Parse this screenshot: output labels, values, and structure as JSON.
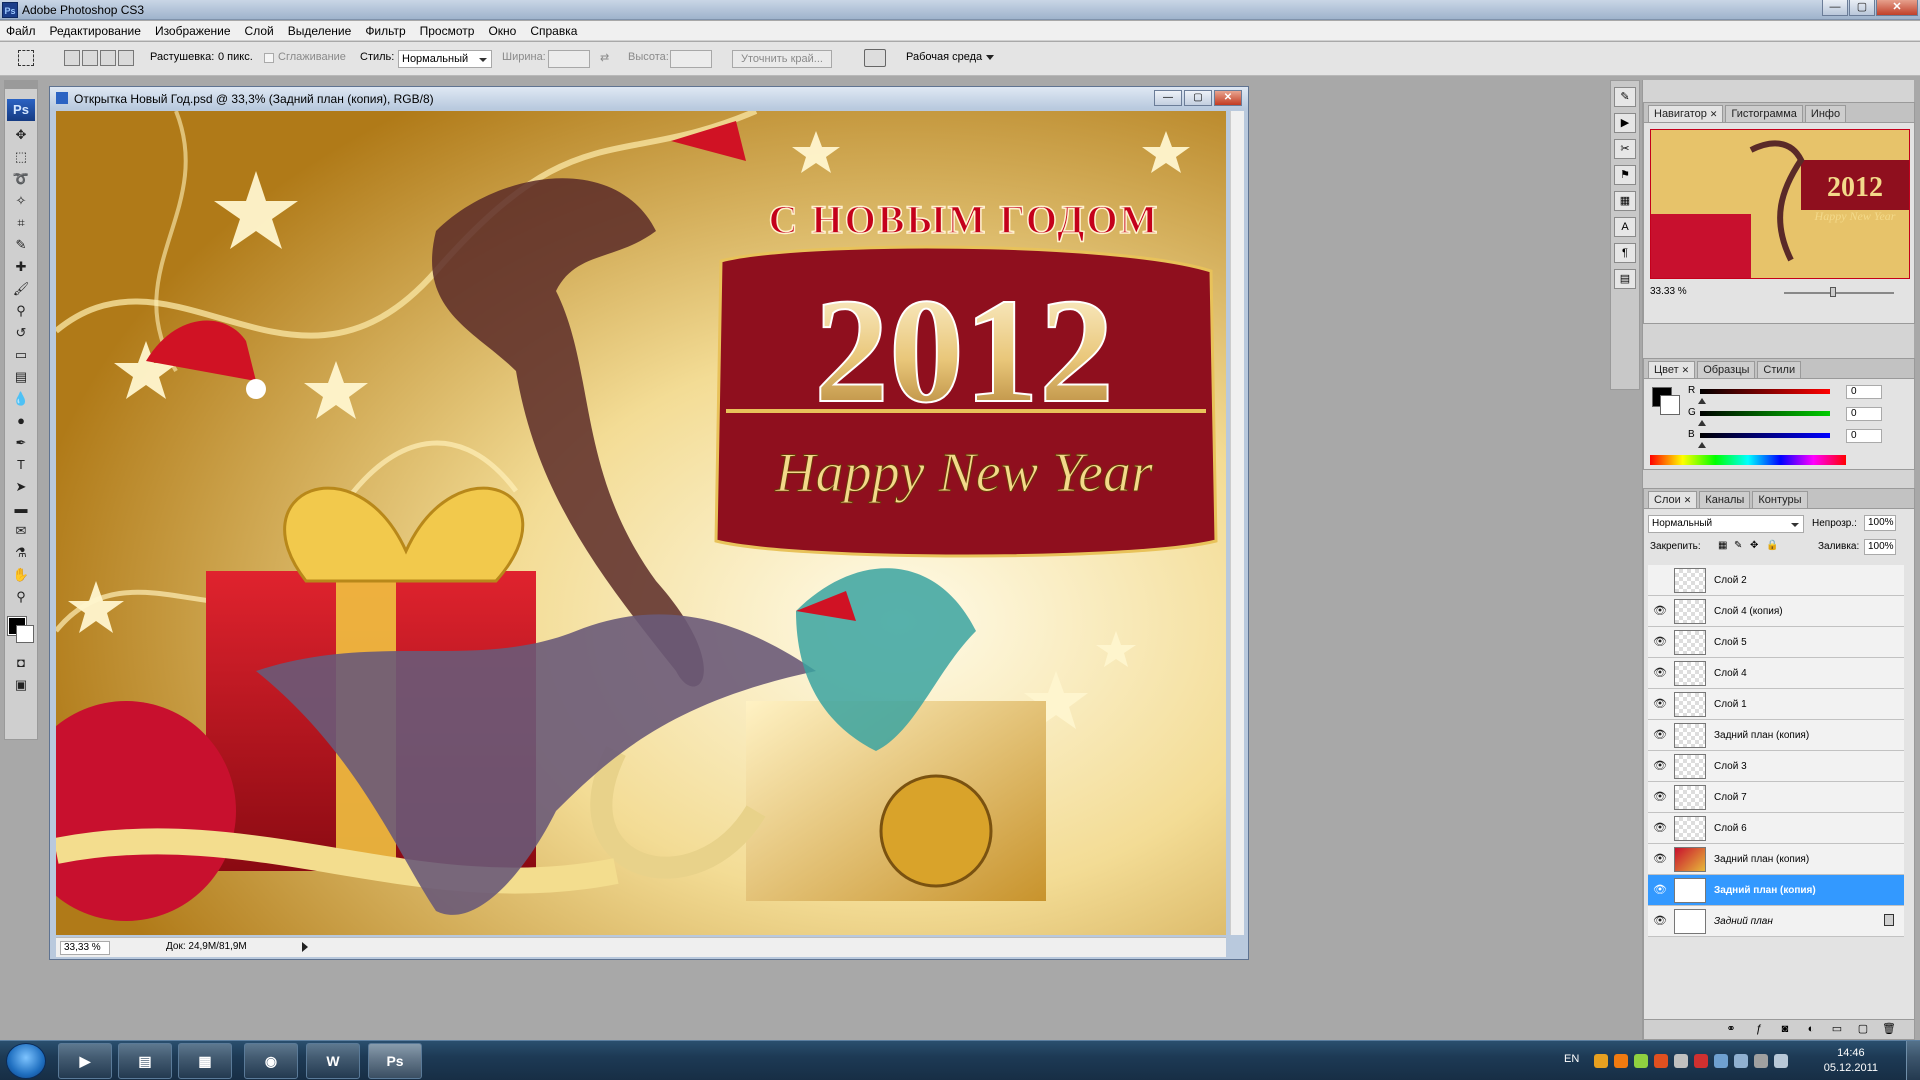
{
  "app": {
    "title": "Adobe Photoshop CS3",
    "icon": "ps-app-icon",
    "window_buttons": {
      "minimize": "—",
      "maximize": "▢",
      "close": "✕"
    }
  },
  "menu": {
    "items": [
      "Файл",
      "Редактирование",
      "Изображение",
      "Слой",
      "Выделение",
      "Фильтр",
      "Просмотр",
      "Окно",
      "Справка"
    ]
  },
  "options_bar": {
    "feather_label": "Растушевка:",
    "feather_value": "0 пикс.",
    "antialias_label": "Сглаживание",
    "style_label": "Стиль:",
    "style_value": "Нормальный",
    "width_label": "Ширина:",
    "height_label": "Высота:",
    "refine_edge": "Уточнить край...",
    "workspace": "Рабочая среда"
  },
  "toolbox": {
    "logo": "Ps",
    "tools": [
      "move-tool-icon",
      "marquee-tool-icon",
      "lasso-tool-icon",
      "magic-wand-icon",
      "crop-tool-icon",
      "slice-tool-icon",
      "healing-brush-icon",
      "brush-tool-icon",
      "clone-stamp-icon",
      "history-brush-icon",
      "eraser-tool-icon",
      "gradient-tool-icon",
      "blur-tool-icon",
      "dodge-tool-icon",
      "pen-tool-icon",
      "type-tool-icon",
      "path-select-icon",
      "shape-tool-icon",
      "notes-tool-icon",
      "eyedropper-icon",
      "hand-tool-icon",
      "zoom-tool-icon"
    ]
  },
  "document": {
    "title": "Открытка Новый Год.psd @ 33,3% (Задний план (копия), RGB/8)",
    "zoom": "33,33 %",
    "doc_size": "Док: 24,9M/81,9M",
    "canvas_text": {
      "greeting": "С НОВЫМ ГОДОМ",
      "year": "2012",
      "english": "Happy New Year"
    }
  },
  "navigator": {
    "tabs": [
      "Навигатор",
      "Гистограмма",
      "Инфо"
    ],
    "zoom": "33.33 %",
    "thumb_year": "2012",
    "thumb_english": "Happy New Year"
  },
  "color_panel": {
    "tabs": [
      "Цвет",
      "Образцы",
      "Стили"
    ],
    "channels": [
      {
        "label": "R",
        "value": "0",
        "color": "#d00000"
      },
      {
        "label": "G",
        "value": "0",
        "color": "#00a000"
      },
      {
        "label": "B",
        "value": "0",
        "color": "#0000d0"
      }
    ]
  },
  "layers_panel": {
    "tabs": [
      "Слои",
      "Каналы",
      "Контуры"
    ],
    "blend_mode": "Нормальный",
    "opacity_label": "Непрозр.:",
    "opacity_value": "100%",
    "lock_label": "Закрепить:",
    "fill_label": "Заливка:",
    "fill_value": "100%",
    "layers": [
      {
        "name": "Слой 2",
        "visible": false,
        "thumb": "checker",
        "selected": false
      },
      {
        "name": "Слой 4 (копия)",
        "visible": true,
        "thumb": "checker",
        "selected": false
      },
      {
        "name": "Слой 5",
        "visible": true,
        "thumb": "checker",
        "selected": false
      },
      {
        "name": "Слой 4",
        "visible": true,
        "thumb": "checker",
        "selected": false
      },
      {
        "name": "Слой 1",
        "visible": true,
        "thumb": "checker",
        "selected": false
      },
      {
        "name": "Задний план (копия)",
        "visible": true,
        "thumb": "checker",
        "selected": false
      },
      {
        "name": "Слой 3",
        "visible": true,
        "thumb": "checker",
        "selected": false
      },
      {
        "name": "Слой 7",
        "visible": true,
        "thumb": "checker",
        "selected": false
      },
      {
        "name": "Слой 6",
        "visible": true,
        "thumb": "checker",
        "selected": false
      },
      {
        "name": "Задний план (копия)",
        "visible": true,
        "thumb": "image",
        "selected": false
      },
      {
        "name": "Задний план (копия)",
        "visible": true,
        "thumb": "white",
        "selected": true
      },
      {
        "name": "Задний план",
        "visible": true,
        "thumb": "white",
        "selected": false,
        "locked": true
      }
    ]
  },
  "taskbar": {
    "apps": [
      {
        "name": "media-player",
        "glyph": "▶"
      },
      {
        "name": "explorer",
        "glyph": "▤"
      },
      {
        "name": "task-manager",
        "glyph": "▦"
      },
      {
        "name": "chrome",
        "glyph": "◉"
      },
      {
        "name": "word",
        "glyph": "W"
      },
      {
        "name": "photoshop",
        "glyph": "Ps"
      }
    ],
    "lang": "EN",
    "time": "14:46",
    "date": "05.12.2011"
  },
  "colors": {
    "selection": "#3399ff",
    "ps_blue": "#2b63c3",
    "canvas_red": "#8f0f1e",
    "canvas_gold": "#e8c25a"
  }
}
